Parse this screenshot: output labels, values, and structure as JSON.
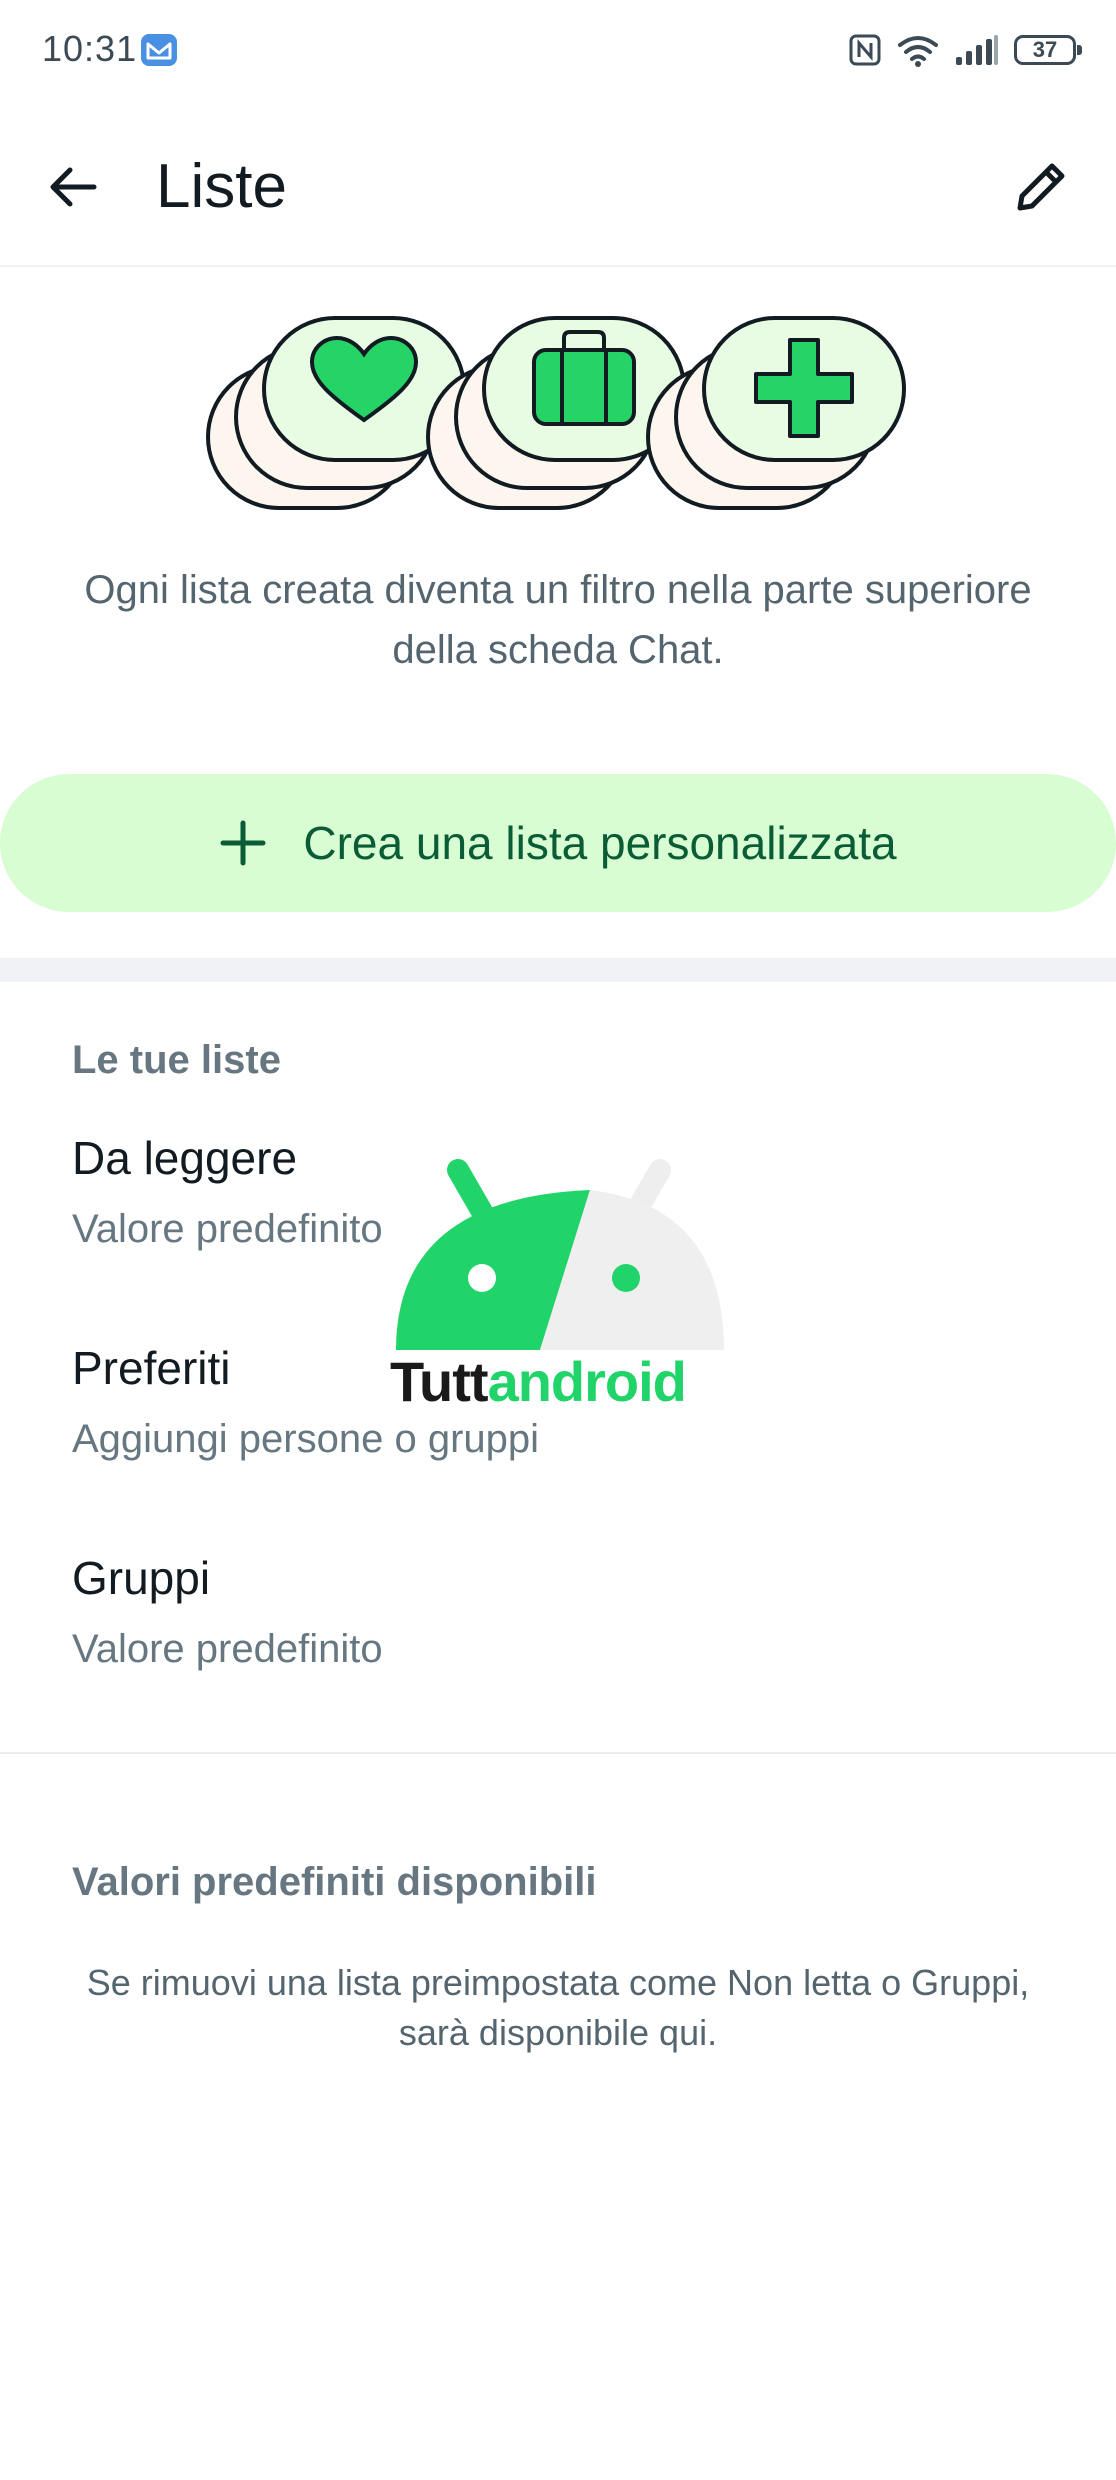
{
  "status_bar": {
    "time": "10:31",
    "battery": "37",
    "icons": [
      "mail-notification-icon",
      "nfc-icon",
      "wifi-icon",
      "signal-icon",
      "battery-icon"
    ]
  },
  "app_bar": {
    "title": "Liste",
    "back_icon": "arrow-left-icon",
    "edit_icon": "pencil-icon"
  },
  "illustration": {
    "icons": [
      "heart-icon",
      "briefcase-icon",
      "plus-icon"
    ],
    "accent": "#25d366",
    "bubble_fill": "#e7fce3",
    "shadow_fill": "#fdf6ee"
  },
  "intro_text": "Ogni lista creata diventa un filtro nella parte superiore della scheda Chat.",
  "create_button": {
    "label": "Crea una lista personalizzata",
    "icon": "plus-icon",
    "background": "#d8fdd2"
  },
  "your_lists": {
    "header": "Le tue liste",
    "items": [
      {
        "title": "Da leggere",
        "subtitle": "Valore predefinito"
      },
      {
        "title": "Preferiti",
        "subtitle": "Aggiungi persone o gruppi"
      },
      {
        "title": "Gruppi",
        "subtitle": "Valore predefinito"
      }
    ]
  },
  "available_presets": {
    "header": "Valori predefiniti disponibili",
    "note": "Se rimuovi una lista preimpostata come Non letta o Gruppi, sarà disponibile qui."
  },
  "watermark": {
    "part1": "Tutt",
    "part2": "android",
    "colors": {
      "dark": "#1a1a1a",
      "green": "#21d46a"
    }
  }
}
